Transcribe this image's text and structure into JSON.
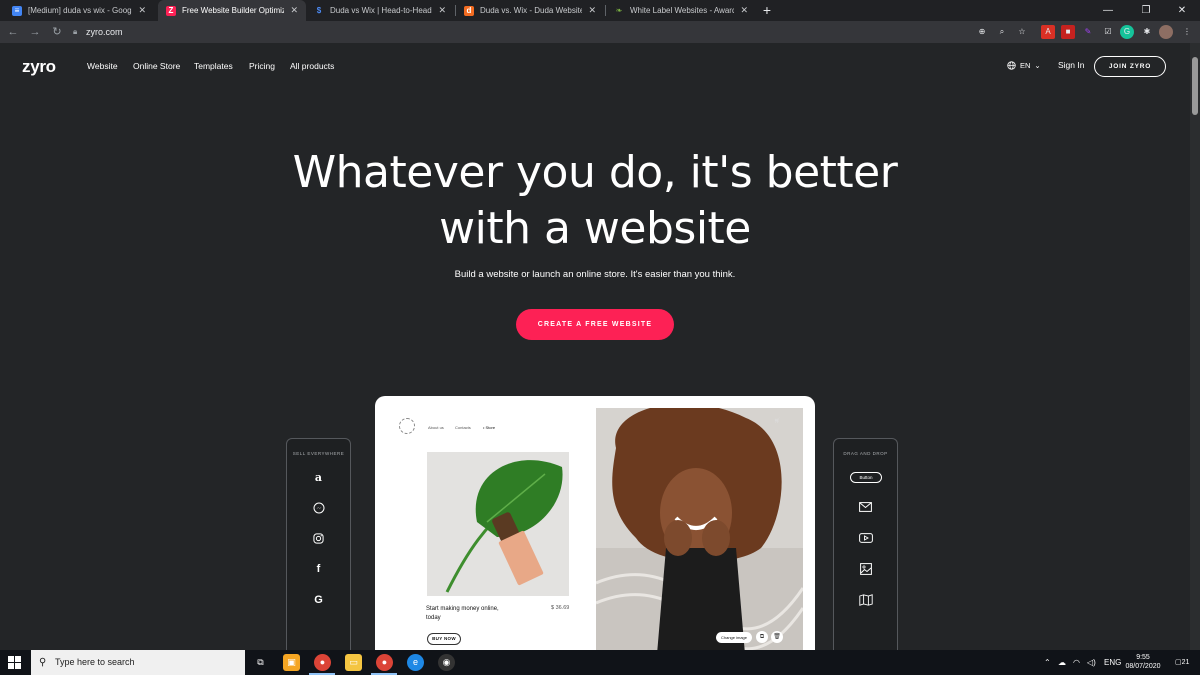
{
  "browser": {
    "tabs": [
      {
        "title": "[Medium] duda vs wix - Google D",
        "favicon": "docs-icon",
        "color": "#4285f4",
        "glyph": "≡"
      },
      {
        "title": "Free Website Builder Optimized f",
        "favicon": "zyro-icon",
        "color": "#fd2155",
        "glyph": "Z",
        "active": true
      },
      {
        "title": "Duda vs Wix | Head-to-Head Cor",
        "favicon": "dollar-icon",
        "color": "#4c8bf5",
        "glyph": "$"
      },
      {
        "title": "Duda vs. Wix - Duda Website Bui",
        "favicon": "duda-icon",
        "color": "#f36c21",
        "glyph": "d"
      },
      {
        "title": "White Label Websites - Award W",
        "favicon": "leaf-icon",
        "color": "#7cb342",
        "glyph": "❧"
      }
    ],
    "url": "zyro.com"
  },
  "site": {
    "logo": "zyro",
    "nav": [
      "Website",
      "Online Store",
      "Templates",
      "Pricing",
      "All products"
    ],
    "language": "EN",
    "sign_in": "Sign In",
    "join": "JOIN ZYRO"
  },
  "hero": {
    "title_line1": "Whatever you do, it's better",
    "title_line2": "with a website",
    "subtitle": "Build a website or launch an online store. It's easier than you think.",
    "cta": "CREATE A FREE WEBSITE"
  },
  "left_panel": {
    "title": "SELL EVERYWHERE",
    "icons": [
      "amazon-icon",
      "messenger-icon",
      "instagram-icon",
      "facebook-icon",
      "google-icon"
    ]
  },
  "right_panel": {
    "title": "DRAG AND DROP",
    "button": "Button",
    "icons": [
      "mail-icon",
      "video-icon",
      "image-icon",
      "map-icon"
    ]
  },
  "mockup": {
    "nav": [
      "About us",
      "Contacts",
      "• Store"
    ],
    "caption": "Start making money online, today",
    "price": "$ 36.69",
    "buy": "BUY NOW",
    "change_image": "Change image"
  },
  "taskbar": {
    "search_placeholder": "Type here to search",
    "language": "ENG",
    "time": "9:55",
    "date": "08/07/2020",
    "notifications": "21"
  }
}
